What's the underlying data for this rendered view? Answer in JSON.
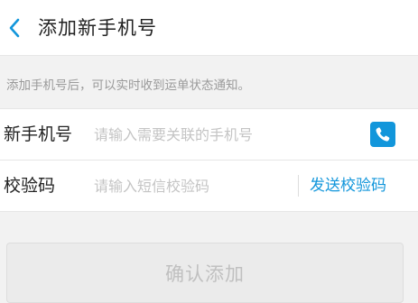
{
  "header": {
    "back_icon": "chevron-left-icon",
    "title": "添加新手机号"
  },
  "notice": "添加手机号后，可以实时收到运单状态通知。",
  "form": {
    "phone": {
      "label": "新手机号",
      "placeholder": "请输入需要关联的手机号",
      "value": "",
      "contacts_icon": "phone-contacts-icon"
    },
    "code": {
      "label": "校验码",
      "placeholder": "请输入短信校验码",
      "value": "",
      "send_label": "发送校验码"
    }
  },
  "confirm_button": "确认添加",
  "colors": {
    "accent": "#1296db",
    "background": "#f2f2f2",
    "disabled_button": "#ebebeb"
  }
}
